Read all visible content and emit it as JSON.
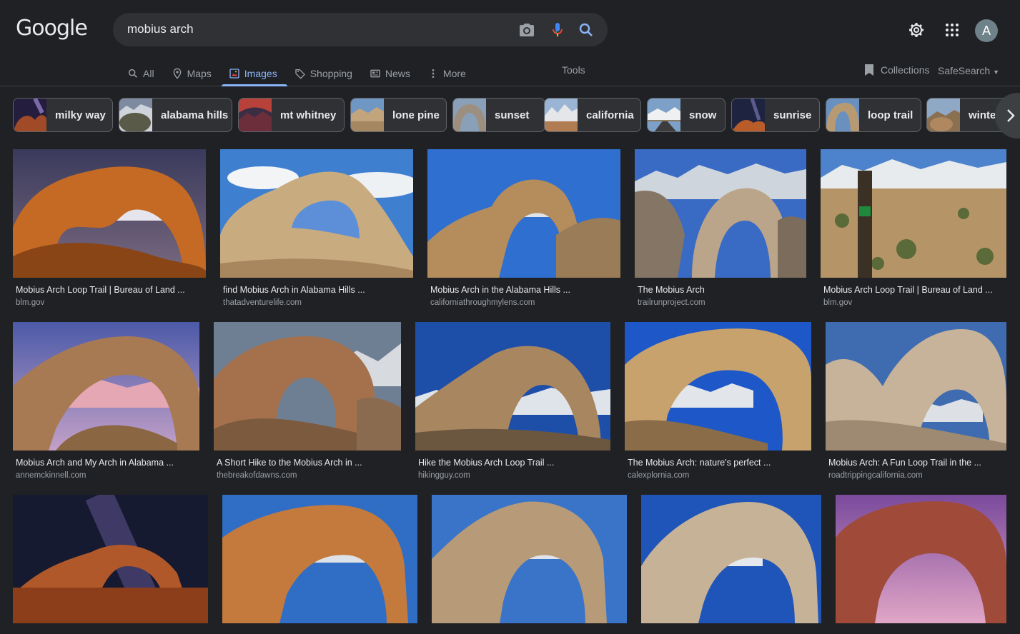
{
  "header": {
    "logo": "Google",
    "search_value": "mobius arch",
    "avatar_letter": "A"
  },
  "tabs": [
    {
      "label": "All",
      "icon": "search-icon",
      "active": false
    },
    {
      "label": "Maps",
      "icon": "map-pin-icon",
      "active": false
    },
    {
      "label": "Images",
      "icon": "image-icon",
      "active": true
    },
    {
      "label": "Shopping",
      "icon": "tag-icon",
      "active": false
    },
    {
      "label": "News",
      "icon": "news-icon",
      "active": false
    },
    {
      "label": "More",
      "icon": "more-vert-icon",
      "active": false
    }
  ],
  "tools_label": "Tools",
  "collections_label": "Collections",
  "safesearch_label": "SafeSearch",
  "chips": [
    {
      "label": "milky way"
    },
    {
      "label": "alabama hills"
    },
    {
      "label": "mt whitney"
    },
    {
      "label": "lone pine"
    },
    {
      "label": "sunset"
    },
    {
      "label": "california"
    },
    {
      "label": "snow"
    },
    {
      "label": "sunrise"
    },
    {
      "label": "loop trail"
    },
    {
      "label": "winter"
    }
  ],
  "results": [
    {
      "title": "Mobius Arch Loop Trail | Bureau of Land ...",
      "site": "blm.gov"
    },
    {
      "title": "find Mobius Arch in Alabama Hills ...",
      "site": "thatadventurelife.com"
    },
    {
      "title": "Mobius Arch in the Alabama Hills ...",
      "site": "californiathroughmylens.com"
    },
    {
      "title": "The Mobius Arch",
      "site": "trailrunproject.com"
    },
    {
      "title": "Mobius Arch Loop Trail | Bureau of Land ...",
      "site": "blm.gov"
    },
    {
      "title": "Mobius Arch and My Arch in Alabama ...",
      "site": "annemckinnell.com"
    },
    {
      "title": "A Short Hike to the Mobius Arch in ...",
      "site": "thebreakofdawns.com"
    },
    {
      "title": "Hike the Mobius Arch Loop Trail ...",
      "site": "hikingguy.com"
    },
    {
      "title": "The Mobius Arch: nature's perfect ...",
      "site": "calexplornia.com"
    },
    {
      "title": "Mobius Arch: A Fun Loop Trail in the ...",
      "site": "roadtrippingcalifornia.com"
    },
    {
      "title": "",
      "site": ""
    },
    {
      "title": "",
      "site": ""
    },
    {
      "title": "",
      "site": ""
    },
    {
      "title": "",
      "site": ""
    },
    {
      "title": "",
      "site": ""
    }
  ]
}
